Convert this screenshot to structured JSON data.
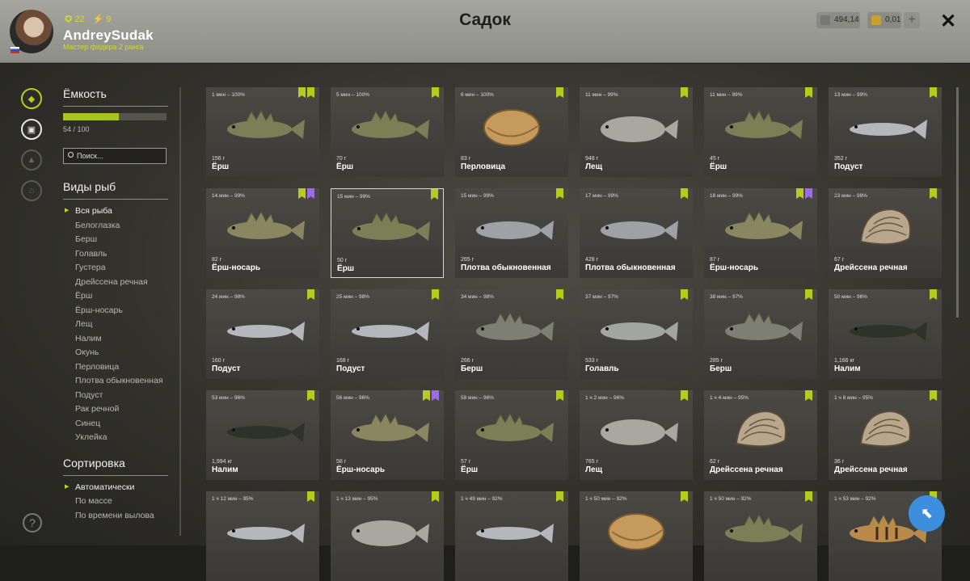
{
  "header": {
    "title": "Садок",
    "username": "AndreySudak",
    "rank": "Мастер фидера 2 ранга",
    "stat1": "22",
    "stat2": "9",
    "silver": "494,14",
    "gold": "0,01",
    "plus": "+",
    "close": "✕"
  },
  "sidebar": {
    "capacity_title": "Ёмкость",
    "capacity": "54 / 100",
    "capacity_fraction": 0.54,
    "search_placeholder": "Поиск...",
    "species_title": "Виды рыб",
    "species": [
      "Вся рыба",
      "Белоглазка",
      "Берш",
      "Голавль",
      "Густера",
      "Дрейссена речная",
      "Ёрш",
      "Ёрш-носарь",
      "Лещ",
      "Налим",
      "Окунь",
      "Перловица",
      "Плотва обыкновенная",
      "Подуст",
      "Рак речной",
      "Синец",
      "Уклейка"
    ],
    "sort_title": "Сортировка",
    "sort": [
      "Автоматически",
      "По массе",
      "По времени вылова"
    ]
  },
  "help": "?",
  "cards": [
    {
      "time": "1 мин – 100%",
      "w": "156 г",
      "n": "Ёрш",
      "tags": [
        "g",
        "g"
      ],
      "k": "ruffe"
    },
    {
      "time": "5 мин – 100%",
      "w": "70 г",
      "n": "Ёрш",
      "tags": [
        "g"
      ],
      "k": "ruffe"
    },
    {
      "time": "6 мин – 100%",
      "w": "83 г",
      "n": "Перловица",
      "tags": [
        "g"
      ],
      "k": "shell"
    },
    {
      "time": "11 мин – 99%",
      "w": "948 г",
      "n": "Лещ",
      "tags": [
        "g"
      ],
      "k": "bream"
    },
    {
      "time": "11 мин – 99%",
      "w": "45 г",
      "n": "Ёрш",
      "tags": [
        "g"
      ],
      "k": "ruffe"
    },
    {
      "time": "13 мин – 99%",
      "w": "352 г",
      "n": "Подуст",
      "tags": [
        "g"
      ],
      "k": "slim"
    },
    {
      "time": "14 мин – 99%",
      "w": "82 г",
      "n": "Ёрш-носарь",
      "tags": [
        "g",
        "p"
      ],
      "k": "perch"
    },
    {
      "time": "15 мин – 99%",
      "w": "50 г",
      "n": "Ёрш",
      "tags": [
        "g"
      ],
      "k": "ruffe",
      "sel": true
    },
    {
      "time": "15 мин – 99%",
      "w": "265 г",
      "n": "Плотва обыкновенная",
      "tags": [
        "g"
      ],
      "k": "roach"
    },
    {
      "time": "17 мин – 99%",
      "w": "428 г",
      "n": "Плотва обыкновенная",
      "tags": [
        "g"
      ],
      "k": "roach"
    },
    {
      "time": "18 мин – 99%",
      "w": "87 г",
      "n": "Ёрш-носарь",
      "tags": [
        "g",
        "p"
      ],
      "k": "perch"
    },
    {
      "time": "23 мин – 98%",
      "w": "67 г",
      "n": "Дрейссена речная",
      "tags": [
        "g"
      ],
      "k": "mussel"
    },
    {
      "time": "24 мин – 98%",
      "w": "160 г",
      "n": "Подуст",
      "tags": [
        "g"
      ],
      "k": "slim"
    },
    {
      "time": "25 мин – 98%",
      "w": "168 г",
      "n": "Подуст",
      "tags": [
        "g"
      ],
      "k": "slim"
    },
    {
      "time": "34 мин – 98%",
      "w": "266 г",
      "n": "Берш",
      "tags": [
        "g"
      ],
      "k": "zander"
    },
    {
      "time": "37 мин – 97%",
      "w": "533 г",
      "n": "Голавль",
      "tags": [
        "g"
      ],
      "k": "chub"
    },
    {
      "time": "38 мин – 97%",
      "w": "285 г",
      "n": "Берш",
      "tags": [
        "g"
      ],
      "k": "zander"
    },
    {
      "time": "50 мин – 96%",
      "w": "1,166 кг",
      "n": "Налим",
      "tags": [
        "g"
      ],
      "k": "burbot"
    },
    {
      "time": "53 мин – 96%",
      "w": "1,994 кг",
      "n": "Налим",
      "tags": [
        "g"
      ],
      "k": "burbot"
    },
    {
      "time": "56 мин – 96%",
      "w": "58 г",
      "n": "Ёрш-носарь",
      "tags": [
        "g",
        "p"
      ],
      "k": "perch"
    },
    {
      "time": "58 мин – 96%",
      "w": "57 г",
      "n": "Ёрш",
      "tags": [
        "g"
      ],
      "k": "ruffe"
    },
    {
      "time": "1 ч 2 мин – 96%",
      "w": "765 г",
      "n": "Лещ",
      "tags": [
        "g"
      ],
      "k": "bream"
    },
    {
      "time": "1 ч 4 мин – 95%",
      "w": "62 г",
      "n": "Дрейссена речная",
      "tags": [
        "g"
      ],
      "k": "mussel"
    },
    {
      "time": "1 ч 8 мин – 95%",
      "w": "36 г",
      "n": "Дрейссена речная",
      "tags": [
        "g"
      ],
      "k": "mussel"
    },
    {
      "time": "1 ч 12 мин – 95%",
      "w": "",
      "n": "",
      "tags": [
        "g"
      ],
      "k": "slim"
    },
    {
      "time": "1 ч 13 мин – 95%",
      "w": "",
      "n": "",
      "tags": [
        "g"
      ],
      "k": "bream"
    },
    {
      "time": "1 ч 49 мин – 92%",
      "w": "",
      "n": "",
      "tags": [
        "g"
      ],
      "k": "slim"
    },
    {
      "time": "1 ч 50 мин – 92%",
      "w": "",
      "n": "",
      "tags": [
        "g"
      ],
      "k": "shell"
    },
    {
      "time": "1 ч 50 мин – 92%",
      "w": "",
      "n": "",
      "tags": [
        "g"
      ],
      "k": "ruffe"
    },
    {
      "time": "1 ч 53 мин – 92%",
      "w": "",
      "n": "",
      "tags": [
        "g"
      ],
      "k": "perch2"
    }
  ],
  "colors": {
    "accent": "#b7cb1f",
    "purple": "#9a6de0",
    "blue": "#3d8fdd"
  },
  "icons": [
    "fish-icon",
    "bucket-icon",
    "bag-icon",
    "home-icon",
    "search-icon",
    "help-icon",
    "cursor-icon",
    "close-icon"
  ]
}
